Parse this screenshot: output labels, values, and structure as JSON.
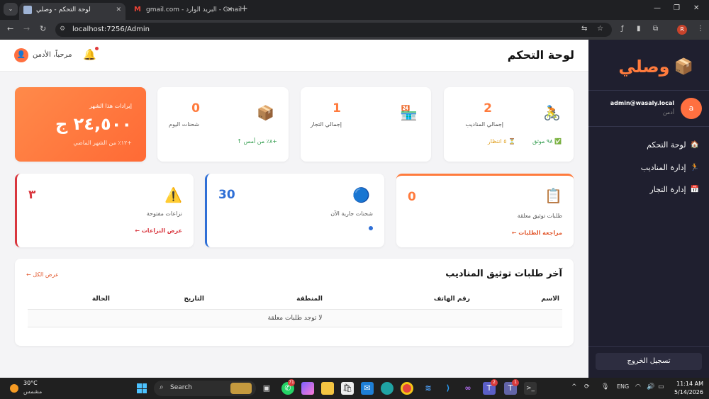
{
  "browser": {
    "tabs": [
      {
        "title": "لوحة التحكم - وصلي",
        "active": true
      },
      {
        "title": "البريد الوارد - Gmail",
        "active": false
      }
    ],
    "gmail_suffix": "gmail.com - ",
    "url": "localhost:7256/Admin",
    "profile_initial": "R"
  },
  "sidebar": {
    "logo_text": "وصلي",
    "logo_icon": "package-icon",
    "user_email": "admin@wasaly.local",
    "user_role": "أدمن",
    "user_initial": "a",
    "menu": [
      {
        "label": "لوحة التحكم",
        "icon": "home-icon"
      },
      {
        "label": "إدارة المناديب",
        "icon": "runner-icon"
      },
      {
        "label": "إدارة التجار",
        "icon": "calendar-icon"
      }
    ],
    "logout_label": "تسجيل الخروج"
  },
  "header": {
    "title": "لوحة التحكم",
    "welcome": "مرحباً، الأدمن",
    "has_notification": true
  },
  "stats": {
    "couriers": {
      "value": "2",
      "label": "إجمالي المناديب",
      "verified": "٩٨ موثق",
      "pending": "٥ انتظار",
      "icon": "cyclist-icon"
    },
    "merchants": {
      "value": "1",
      "label": "إجمالي التجار",
      "icon": "store-icon"
    },
    "today": {
      "value": "0",
      "label": "شحنات اليوم",
      "change": "+٨٪ من أمس ↑",
      "icon": "box-icon"
    },
    "revenue": {
      "label": "إيرادات هذا الشهر",
      "value": "٢٤,٥٠٠ ج",
      "change": "+١٢٪ من الشهر الماضي"
    }
  },
  "status_cards": {
    "pending": {
      "value": "0",
      "label": "طلبات توثيق معلقة",
      "link": "مراجعة الطلبات ←",
      "icon": "clipboard-icon",
      "accent": "#ff7b3d"
    },
    "active": {
      "value": "30",
      "label": "شحنات جارية الآن",
      "icon": "globe-icon",
      "accent": "#2f6fd6"
    },
    "disputes": {
      "value": "٣",
      "label": "نزاعات مفتوحة",
      "link": "عرض النزاعات ←",
      "icon": "warning-icon",
      "accent": "#d9363e"
    }
  },
  "table": {
    "title": "آخر طلبات توثيق المناديب",
    "view_all": "عرض الكل ←",
    "headers": [
      "الاسم",
      "رقم الهاتف",
      "المنطقة",
      "التاريخ",
      "الحالة"
    ],
    "empty_text": "لا توجد طلبات معلقة"
  },
  "taskbar": {
    "temperature": "30°C",
    "condition": "مشمس",
    "search_label": "Search",
    "badges": [
      "71",
      "2",
      "1"
    ],
    "language": "ENG",
    "time": "11:14 AM",
    "date": "5/14/2026"
  }
}
